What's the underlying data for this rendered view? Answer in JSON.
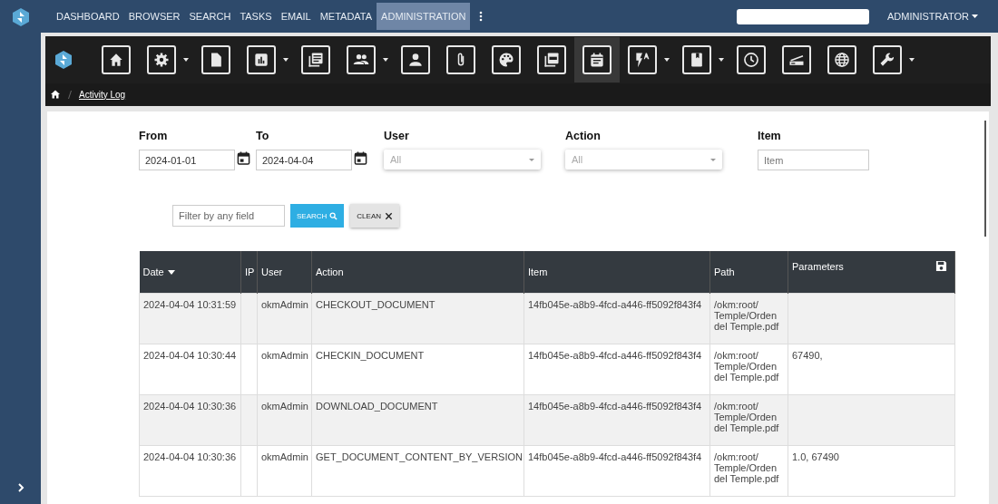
{
  "nav": {
    "items": [
      {
        "label": "DASHBOARD",
        "selected": false
      },
      {
        "label": "BROWSER",
        "selected": false
      },
      {
        "label": "SEARCH",
        "selected": false
      },
      {
        "label": "TASKS",
        "selected": false
      },
      {
        "label": "EMAIL",
        "selected": false
      },
      {
        "label": "METADATA",
        "selected": false
      },
      {
        "label": "ADMINISTRATION",
        "selected": true
      }
    ],
    "user_menu": "ADMINISTRATOR"
  },
  "toolbar": [
    {
      "kind": "home",
      "dropdown": false,
      "selected": false
    },
    {
      "kind": "gear",
      "dropdown": true,
      "selected": false
    },
    {
      "kind": "document",
      "dropdown": false,
      "selected": false
    },
    {
      "kind": "chart",
      "dropdown": true,
      "selected": false
    },
    {
      "kind": "list",
      "dropdown": false,
      "selected": false
    },
    {
      "kind": "users",
      "dropdown": true,
      "selected": false
    },
    {
      "kind": "user",
      "dropdown": false,
      "selected": false
    },
    {
      "kind": "clip",
      "dropdown": false,
      "selected": false
    },
    {
      "kind": "palette",
      "dropdown": false,
      "selected": false
    },
    {
      "kind": "pdf",
      "dropdown": false,
      "selected": false
    },
    {
      "kind": "calendar",
      "dropdown": false,
      "selected": true
    },
    {
      "kind": "flash",
      "dropdown": true,
      "selected": false
    },
    {
      "kind": "book",
      "dropdown": true,
      "selected": false
    },
    {
      "kind": "clock",
      "dropdown": false,
      "selected": false
    },
    {
      "kind": "scanner",
      "dropdown": false,
      "selected": false
    },
    {
      "kind": "globe",
      "dropdown": false,
      "selected": false
    },
    {
      "kind": "wrench",
      "dropdown": true,
      "selected": false
    }
  ],
  "breadcrumb": {
    "current": "Activity Log"
  },
  "filters": [
    {
      "kind": "date",
      "label": "From",
      "value": "2024-01-01"
    },
    {
      "kind": "date",
      "label": "To",
      "value": "2024-04-04"
    },
    {
      "kind": "select",
      "label": "User",
      "placeholder": "All"
    },
    {
      "kind": "select",
      "label": "Action",
      "placeholder": "All"
    },
    {
      "kind": "text",
      "label": "Item",
      "placeholder": "Item"
    }
  ],
  "quick_filter": {
    "placeholder": "Filter by any field"
  },
  "buttons": {
    "search": "SEARCH",
    "clean": "CLEAN"
  },
  "table": {
    "columns": [
      {
        "label": "Date",
        "sorted": true
      },
      {
        "label": "IP",
        "sorted": false
      },
      {
        "label": "User",
        "sorted": false
      },
      {
        "label": "Action",
        "sorted": false
      },
      {
        "label": "Item",
        "sorted": false
      },
      {
        "label": "Path",
        "sorted": false
      },
      {
        "label": "Parameters",
        "sorted": false
      }
    ],
    "rows": [
      [
        "2024-04-04 10:31:59",
        "",
        "okmAdmin",
        "CHECKOUT_DOCUMENT",
        "14fb045e-a8b9-4fcd-a446-ff5092f843f4",
        "/okm:root/Temple/Orden del Temple.pdf",
        ""
      ],
      [
        "2024-04-04 10:30:44",
        "",
        "okmAdmin",
        "CHECKIN_DOCUMENT",
        "14fb045e-a8b9-4fcd-a446-ff5092f843f4",
        "/okm:root/Temple/Orden del Temple.pdf",
        "67490,"
      ],
      [
        "2024-04-04 10:30:36",
        "",
        "okmAdmin",
        "DOWNLOAD_DOCUMENT",
        "14fb045e-a8b9-4fcd-a446-ff5092f843f4",
        "/okm:root/Temple/Orden del Temple.pdf",
        ""
      ],
      [
        "2024-04-04 10:30:36",
        "",
        "okmAdmin",
        "GET_DOCUMENT_CONTENT_BY_VERSION",
        "14fb045e-a8b9-4fcd-a446-ff5092f843f4",
        "/okm:root/Temple/Orden del Temple.pdf",
        "1.0, 67490"
      ]
    ]
  }
}
